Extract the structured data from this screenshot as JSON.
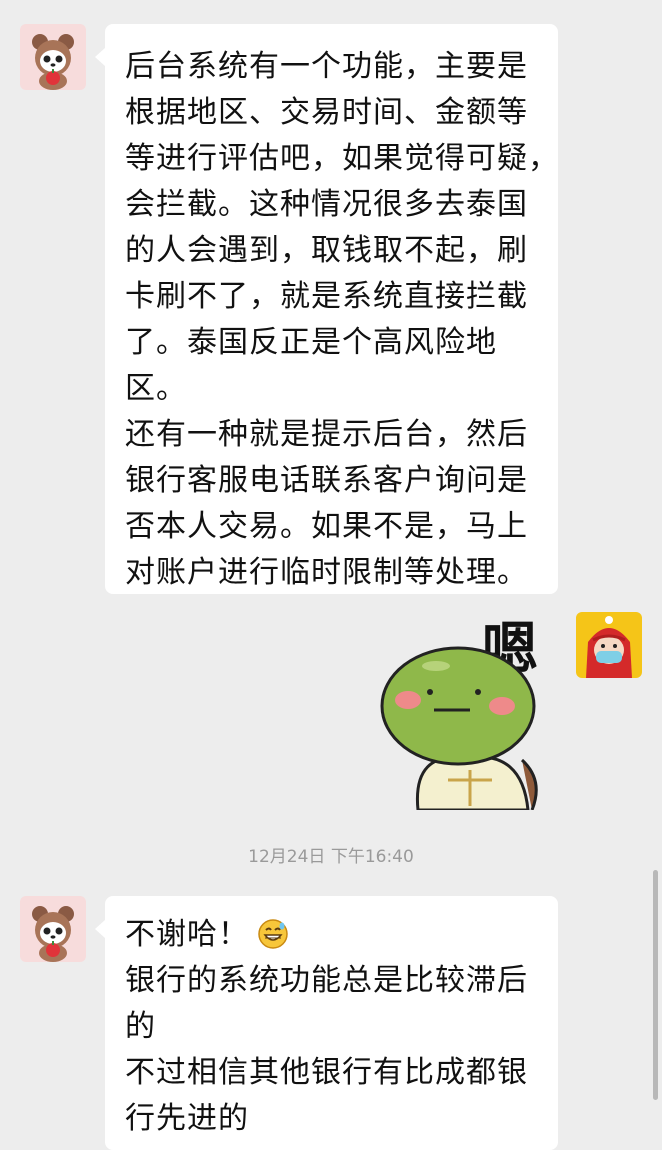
{
  "messages": [
    {
      "sender": "other",
      "avatar_icon": "panda-bear-avatar-icon",
      "lines": [
        "后台系统有一个功能，主要是",
        "根据地区、交易时间、金额等",
        "等进行评估吧，如果觉得可疑，",
        "会拦截。这种情况很多去泰国",
        "的人会遇到，取钱取不起，刷",
        "卡刷不了，就是系统直接拦截",
        "了。泰国反正是个高风险地",
        "区。",
        "还有一种就是提示后台，然后",
        "银行客服电话联系客户询问是",
        "否本人交易。如果不是，马上",
        "对账户进行临时限制等处理。"
      ]
    },
    {
      "sender": "self",
      "avatar_icon": "red-hood-mask-avatar-icon",
      "sticker": {
        "icon": "turtle-sticker-icon",
        "text": "嗯"
      }
    },
    {
      "type": "timestamp",
      "text": "12月24日 下午16:40"
    },
    {
      "sender": "other",
      "avatar_icon": "panda-bear-avatar-icon",
      "lines": [
        "不谢哈！",
        "银行的系统功能总是比较滞后",
        "的",
        "不过相信其他银行有比成都银",
        "行先进的"
      ],
      "inline_emoji": "grinning-sweat-emoji-icon"
    }
  ],
  "colors": {
    "background": "#ededed",
    "bubble": "#ffffff",
    "text": "#111111",
    "timestamp": "#9a9a9a"
  }
}
